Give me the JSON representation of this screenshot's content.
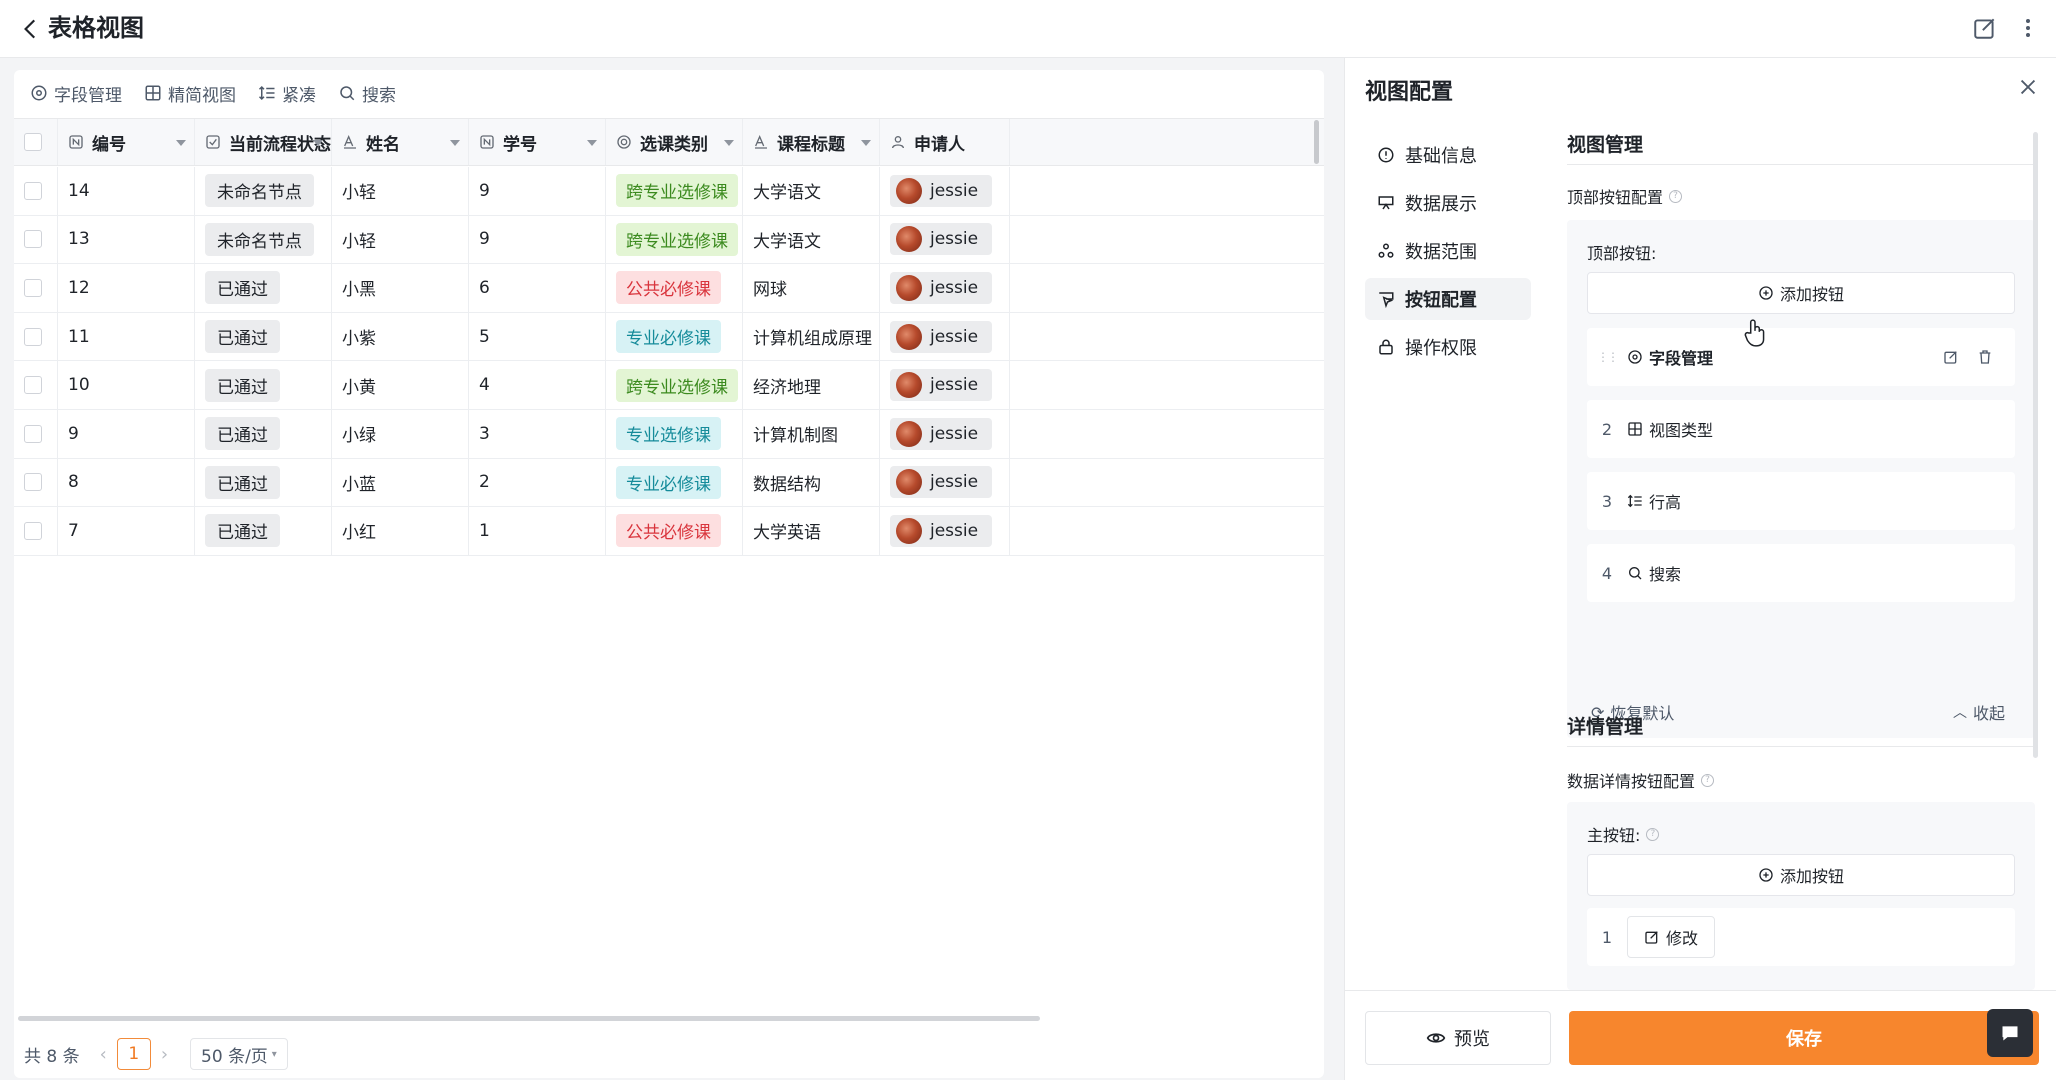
{
  "header": {
    "title": "表格视图"
  },
  "toolbar": [
    {
      "label": "字段管理",
      "icon": "field-settings-icon"
    },
    {
      "label": "精简视图",
      "icon": "grid-icon"
    },
    {
      "label": "紧凑",
      "icon": "row-height-icon"
    },
    {
      "label": "搜索",
      "icon": "search-icon"
    }
  ],
  "table": {
    "columns": [
      {
        "label": "编号",
        "icon": "number-icon"
      },
      {
        "label": "当前流程状态",
        "icon": "checkbox-icon"
      },
      {
        "label": "姓名",
        "icon": "text-icon"
      },
      {
        "label": "学号",
        "icon": "number-icon"
      },
      {
        "label": "选课类别",
        "icon": "select-icon"
      },
      {
        "label": "课程标题",
        "icon": "text-icon"
      },
      {
        "label": "申请人",
        "icon": "user-icon"
      }
    ],
    "rows": [
      {
        "id": "14",
        "status": "未命名节点",
        "name": "小轻",
        "sid": "9",
        "category": "跨专业选修课",
        "category_color": "green",
        "course": "大学语文",
        "applicant": "jessie"
      },
      {
        "id": "13",
        "status": "未命名节点",
        "name": "小轻",
        "sid": "9",
        "category": "跨专业选修课",
        "category_color": "green",
        "course": "大学语文",
        "applicant": "jessie"
      },
      {
        "id": "12",
        "status": "已通过",
        "name": "小黑",
        "sid": "6",
        "category": "公共必修课",
        "category_color": "red",
        "course": "网球",
        "applicant": "jessie"
      },
      {
        "id": "11",
        "status": "已通过",
        "name": "小紫",
        "sid": "5",
        "category": "专业必修课",
        "category_color": "cyan",
        "course": "计算机组成原理",
        "applicant": "jessie"
      },
      {
        "id": "10",
        "status": "已通过",
        "name": "小黄",
        "sid": "4",
        "category": "跨专业选修课",
        "category_color": "green",
        "course": "经济地理",
        "applicant": "jessie"
      },
      {
        "id": "9",
        "status": "已通过",
        "name": "小绿",
        "sid": "3",
        "category": "专业选修课",
        "category_color": "cyan",
        "course": "计算机制图",
        "applicant": "jessie"
      },
      {
        "id": "8",
        "status": "已通过",
        "name": "小蓝",
        "sid": "2",
        "category": "专业必修课",
        "category_color": "cyan",
        "course": "数据结构",
        "applicant": "jessie"
      },
      {
        "id": "7",
        "status": "已通过",
        "name": "小红",
        "sid": "1",
        "category": "公共必修课",
        "category_color": "red",
        "course": "大学英语",
        "applicant": "jessie"
      }
    ]
  },
  "tag_colors": {
    "green": {
      "bg": "#e3f5d4",
      "fg": "#3b8a1e"
    },
    "red": {
      "bg": "#fddfe0",
      "fg": "#d9343c"
    },
    "cyan": {
      "bg": "#d7f2f5",
      "fg": "#158b9a"
    }
  },
  "pager": {
    "total": "共 8 条",
    "page": "1",
    "size": "50 条/页"
  },
  "config": {
    "title": "视图配置",
    "menu": [
      {
        "label": "基础信息",
        "icon": "info-icon",
        "active": false
      },
      {
        "label": "数据展示",
        "icon": "display-icon",
        "active": false
      },
      {
        "label": "数据范围",
        "icon": "range-icon",
        "active": false
      },
      {
        "label": "按钮配置",
        "icon": "button-config-icon",
        "active": true
      },
      {
        "label": "操作权限",
        "icon": "lock-icon",
        "active": false
      }
    ],
    "view_manage": {
      "title": "视图管理",
      "top_config_label": "顶部按钮配置",
      "top_buttons_label": "顶部按钮:",
      "add_label": "添加按钮",
      "items": [
        {
          "index": "⋮⋮",
          "label": "字段管理",
          "icon": "field-settings-icon",
          "bold": true
        },
        {
          "index": "2",
          "label": "视图类型",
          "icon": "grid-icon",
          "bold": false
        },
        {
          "index": "3",
          "label": "行高",
          "icon": "row-height-icon",
          "bold": false
        },
        {
          "index": "4",
          "label": "搜索",
          "icon": "search-icon",
          "bold": false
        }
      ],
      "reset_label": "恢复默认",
      "collapse_label": "收起"
    },
    "detail_manage": {
      "title": "详情管理",
      "config_label": "数据详情按钮配置",
      "main_label": "主按钮:",
      "add_label": "添加按钮",
      "first_item": {
        "index": "1",
        "label": "修改"
      }
    },
    "footer": {
      "preview_label": "预览",
      "save_label": "保存"
    }
  },
  "accent_color": "#f7862d"
}
